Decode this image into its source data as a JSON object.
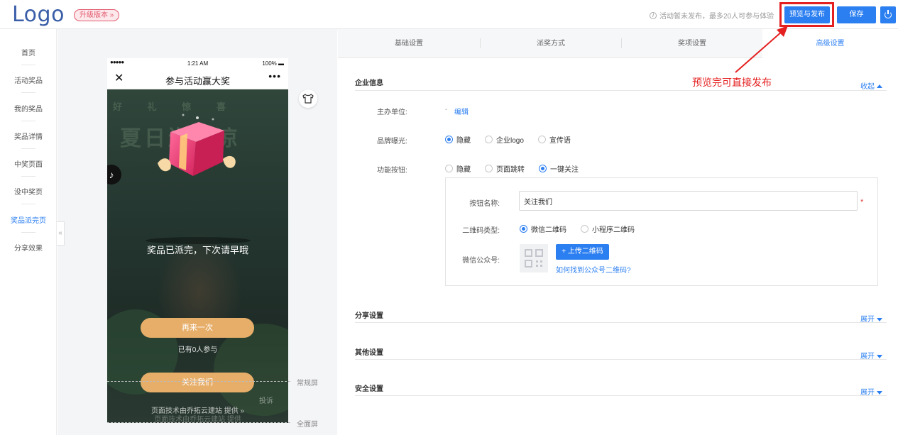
{
  "header": {
    "logo": "Logo",
    "upgrade_label": "升级版本 »",
    "notice": "活动暂未发布，最多20人可参与体验",
    "preview_publish_label": "预览与发布",
    "save_label": "保存"
  },
  "annotation": "预览完可直接发布",
  "sidebar": {
    "items": [
      {
        "label": "首页"
      },
      {
        "label": "活动奖品"
      },
      {
        "label": "我的奖品"
      },
      {
        "label": "奖品详情"
      },
      {
        "label": "中奖页面"
      },
      {
        "label": "没中奖页"
      },
      {
        "label": "奖品派完页"
      },
      {
        "label": "分享效果"
      }
    ],
    "active_index": 6
  },
  "collapse_label": "«",
  "phone": {
    "signal": "●●●●●",
    "time": "1:21 AM",
    "battery": "100% ▬",
    "nav_title": "参与活动赢大奖",
    "close_icon": "✕",
    "more_icon": "•••",
    "bg_deco_small": "好 礼 惊 喜",
    "bg_deco_big": "夏日送清凉",
    "prize_message": "奖品已派完，下次请早哦",
    "again_button": "再来一次",
    "joined_text": "已有0人参与",
    "follow_button": "关注我们",
    "report": "投诉",
    "powered": "页面技术由乔拓云建站 提供 »",
    "powered_shadow": "页面技术由乔拓云建站 提供"
  },
  "screen_labels": {
    "normal": "常规屏",
    "full": "全面屏"
  },
  "tabs": [
    {
      "label": "基础设置"
    },
    {
      "label": "派奖方式"
    },
    {
      "label": "奖项设置"
    },
    {
      "label": "高级设置"
    }
  ],
  "enterprise": {
    "title": "企业信息",
    "toggle": "收起",
    "organizer_label": "主办单位:",
    "organizer_value": "-",
    "edit_link": "编辑",
    "brand_label": "品牌曝光:",
    "brand_options": [
      "隐藏",
      "企业logo",
      "宣传语"
    ],
    "brand_selected": 0,
    "func_label": "功能按钮:",
    "func_options": [
      "隐藏",
      "页面跳转",
      "一键关注"
    ],
    "func_selected": 2,
    "button_name_label": "按钮名称:",
    "button_name_value": "关注我们",
    "required_mark": "*",
    "qr_type_label": "二维码类型:",
    "qr_type_options": [
      "微信二维码",
      "小程序二维码"
    ],
    "qr_type_selected": 0,
    "wechat_label": "微信公众号:",
    "upload_label": "+ 上传二维码",
    "help_link": "如何找到公众号二维码?"
  },
  "sections": [
    {
      "title": "分享设置",
      "toggle": "展开"
    },
    {
      "title": "其他设置",
      "toggle": "展开"
    },
    {
      "title": "安全设置",
      "toggle": "展开"
    }
  ],
  "colors": {
    "primary": "#2c7ff1",
    "accent_red": "#e52020",
    "pill_gold": "#e7ae6a",
    "logo_blue": "#3a5ea8"
  }
}
